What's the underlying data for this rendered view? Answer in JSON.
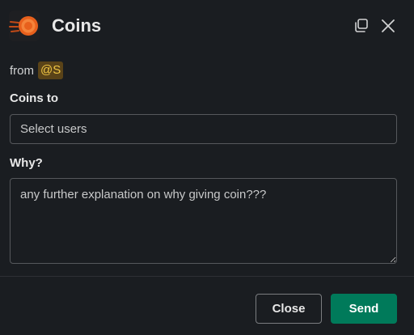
{
  "modal": {
    "title": "Coins",
    "app_icon": "coin-icon",
    "accent_color": "#007a5a"
  },
  "header": {
    "popout_icon": "popout-window-icon",
    "close_icon": "close-icon"
  },
  "from": {
    "label": "from",
    "mention": "@S"
  },
  "coins_to": {
    "label": "Coins to",
    "placeholder": "Select users"
  },
  "why": {
    "label": "Why?",
    "placeholder": "any further explanation on why giving coin???"
  },
  "footer": {
    "close_label": "Close",
    "send_label": "Send"
  }
}
